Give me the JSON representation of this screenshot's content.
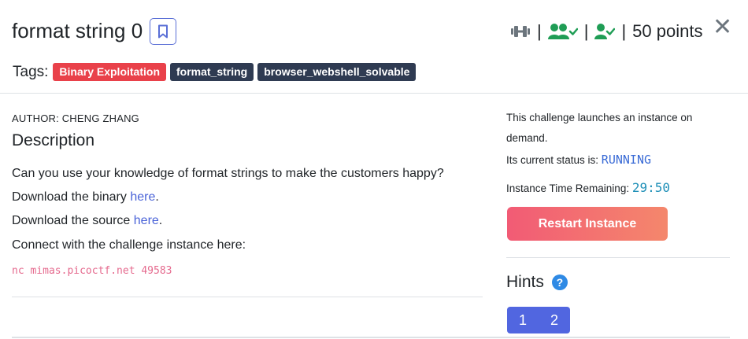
{
  "challenge": {
    "title": "format string 0",
    "points_label": "50 points",
    "separator": "|"
  },
  "tags": {
    "label": "Tags:",
    "items": [
      "Binary Exploitation",
      "format_string",
      "browser_webshell_solvable"
    ]
  },
  "content": {
    "author": "AUTHOR: CHENG ZHANG",
    "description_title": "Description",
    "line1": "Can you use your knowledge of format strings to make the customers happy?",
    "download_binary_prefix": "Download the binary ",
    "download_source_prefix": "Download the source ",
    "link_text": "here",
    "period": ".",
    "connect_text": "Connect with the challenge instance here:",
    "nc_command": "nc mimas.picoctf.net 49583"
  },
  "instance": {
    "launch_text": "This challenge launches an instance on",
    "launch_text_2": "demand.",
    "status_label": "Its current status is: ",
    "status_value": "RUNNING",
    "time_label": "Instance Time Remaining: ",
    "time_value": "29:50",
    "restart_label": "Restart Instance"
  },
  "hints": {
    "title": "Hints",
    "help_glyph": "?",
    "items": [
      "1",
      "2"
    ]
  },
  "icons": {
    "difficulty": "dumbbell-icon",
    "solvers": "users-check-icon",
    "solved": "user-check-icon",
    "bookmark": "bookmark-icon",
    "close": "close-icon"
  },
  "colors": {
    "accent": "#5166e0",
    "tag_red": "#e9414a",
    "tag_navy": "#2f3b52",
    "success": "#1f9d55"
  }
}
